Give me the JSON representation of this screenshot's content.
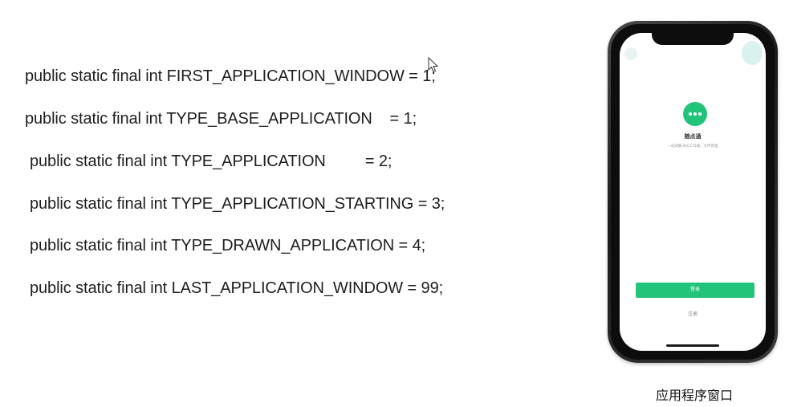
{
  "code_lines": [
    "public static final int FIRST_APPLICATION_WINDOW = 1;",
    "public static final int TYPE_BASE_APPLICATION    = 1;",
    "public static final int TYPE_APPLICATION         = 2;",
    "public static final int TYPE_APPLICATION_STARTING = 3;",
    "public static final int TYPE_DRAWN_APPLICATION = 4;",
    "public static final int LAST_APPLICATION_WINDOW = 99;"
  ],
  "phone": {
    "app_name": "随点通",
    "tagline": "一站式解决员工沟通、文件管理",
    "login_label": "登录",
    "register_label": "注册",
    "logo_icon": "chat-bubble-icon",
    "accent_color": "#22c47a"
  },
  "caption": "应用程序窗口",
  "cursor_icon": "mouse-pointer-icon"
}
